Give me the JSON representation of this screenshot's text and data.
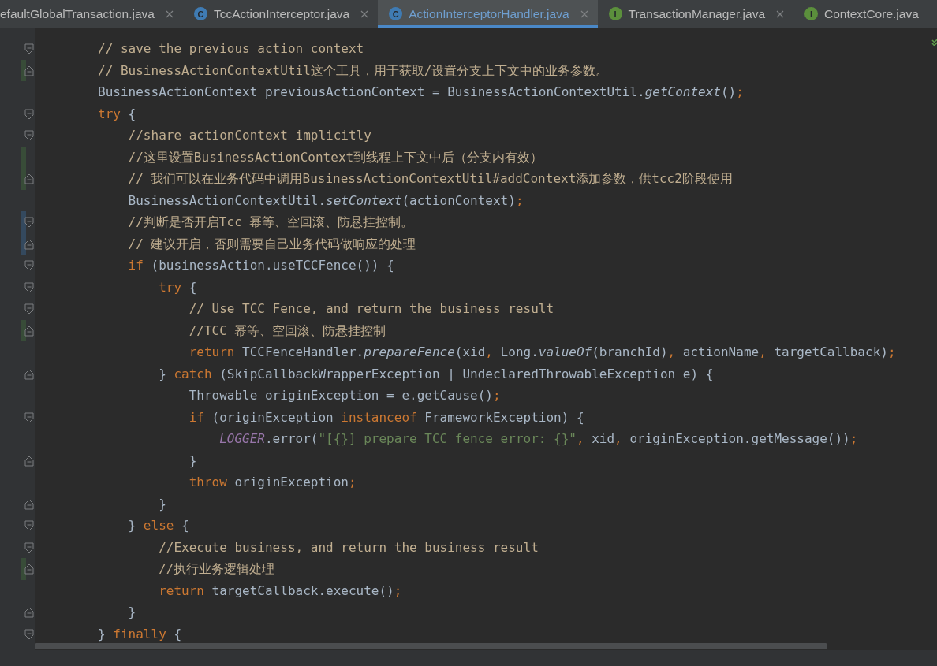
{
  "tabs": [
    {
      "label": "efaultGlobalTransaction.java",
      "selected": false,
      "closable": true
    },
    {
      "label": "TccActionInterceptor.java",
      "kind": "class",
      "icon_letter": "C",
      "selected": false,
      "closable": true
    },
    {
      "label": "ActionInterceptorHandler.java",
      "kind": "class",
      "icon_letter": "C",
      "selected": true,
      "closable": true
    },
    {
      "label": "TransactionManager.java",
      "kind": "interface",
      "icon_letter": "I",
      "selected": false,
      "closable": true
    },
    {
      "label": "ContextCore.java",
      "kind": "interface",
      "icon_letter": "I",
      "selected": false,
      "closable": false
    }
  ],
  "editor": {
    "lines": [
      {
        "fold_start": true,
        "fold_end": false,
        "tokens": [
          {
            "kind": "comment",
            "text": "// save the previous action context"
          }
        ]
      },
      {
        "fold_start": false,
        "fold_end": true,
        "color": "#384c38",
        "tokens": [
          {
            "kind": "comment",
            "text": "// BusinessActionContextUtil这个工具，用于获取/设置分支上下文中的业务参数。"
          }
        ]
      },
      {
        "fold_start": false,
        "fold_end": false,
        "tokens": [
          {
            "kind": "plain",
            "text": "BusinessActionContext previousActionContext = BusinessActionContextUtil."
          },
          {
            "kind": "method",
            "text": "getContext"
          },
          {
            "kind": "plain",
            "text": "()"
          },
          {
            "kind": "punct",
            "text": ";"
          }
        ]
      },
      {
        "fold_start": true,
        "fold_end": false,
        "tokens": [
          {
            "kind": "keyword",
            "text": "try"
          },
          {
            "kind": "plain",
            "text": " {"
          }
        ],
        "children": [
          {
            "fold_start": true,
            "fold_end": false,
            "tokens": [
              {
                "kind": "comment",
                "text": "//share actionContext implicitly"
              }
            ]
          },
          {
            "fold_start": false,
            "fold_end": false,
            "color": "#384c38",
            "tokens": [
              {
                "kind": "comment",
                "text": "//这里设置BusinessActionContext到线程上下文中后（分支内有效）"
              }
            ]
          },
          {
            "fold_start": false,
            "fold_end": true,
            "color": "#384c38",
            "tokens": [
              {
                "kind": "comment",
                "text": "// 我们可以在业务代码中调用BusinessActionContextUtil#addContext添加参数，供tcc2阶段使用"
              }
            ]
          },
          {
            "fold_start": false,
            "fold_end": false,
            "tokens": [
              {
                "kind": "plain",
                "text": "BusinessActionContextUtil."
              },
              {
                "kind": "method",
                "text": "setContext"
              },
              {
                "kind": "plain",
                "text": "(actionContext)"
              },
              {
                "kind": "punct",
                "text": ";"
              }
            ]
          },
          {
            "fold_start": true,
            "fold_end": false,
            "color": "#34495e",
            "tokens": [
              {
                "kind": "comment",
                "text": "//判断是否开启Tcc 幂等、空回滚、防悬挂控制。"
              }
            ]
          },
          {
            "fold_start": false,
            "fold_end": true,
            "color": "#34495e",
            "tokens": [
              {
                "kind": "comment",
                "text": "// 建议开启，否则需要自己业务代码做响应的处理"
              }
            ]
          },
          {
            "fold_start": true,
            "fold_end": false,
            "tokens": [
              {
                "kind": "keyword",
                "text": "if"
              },
              {
                "kind": "plain",
                "text": " (businessAction.useTCCFence()) {"
              }
            ],
            "children": [
              {
                "fold_start": true,
                "fold_end": false,
                "tokens": [
                  {
                    "kind": "keyword",
                    "text": "try"
                  },
                  {
                    "kind": "plain",
                    "text": " {"
                  }
                ],
                "children": [
                  {
                    "fold_start": true,
                    "fold_end": false,
                    "tokens": [
                      {
                        "kind": "comment",
                        "text": "// Use TCC Fence, and return the business result"
                      }
                    ]
                  },
                  {
                    "fold_start": false,
                    "fold_end": true,
                    "color": "#384c38",
                    "tokens": [
                      {
                        "kind": "comment",
                        "text": "//TCC 幂等、空回滚、防悬挂控制"
                      }
                    ]
                  },
                  {
                    "fold_start": false,
                    "fold_end": false,
                    "tokens": [
                      {
                        "kind": "keyword",
                        "text": "return"
                      },
                      {
                        "kind": "plain",
                        "text": " TCCFenceHandler."
                      },
                      {
                        "kind": "method",
                        "text": "prepareFence"
                      },
                      {
                        "kind": "plain",
                        "text": "(xid"
                      },
                      {
                        "kind": "punct",
                        "text": ", "
                      },
                      {
                        "kind": "plain",
                        "text": "Long."
                      },
                      {
                        "kind": "method",
                        "text": "valueOf"
                      },
                      {
                        "kind": "plain",
                        "text": "(branchId)"
                      },
                      {
                        "kind": "punct",
                        "text": ", "
                      },
                      {
                        "kind": "plain",
                        "text": "actionName"
                      },
                      {
                        "kind": "punct",
                        "text": ", "
                      },
                      {
                        "kind": "plain",
                        "text": "targetCallback)"
                      },
                      {
                        "kind": "punct",
                        "text": ";"
                      }
                    ]
                  }
                ]
              },
              {
                "fold_start": false,
                "fold_end": true,
                "tokens": [
                  {
                    "kind": "plain",
                    "text": "} "
                  },
                  {
                    "kind": "keyword",
                    "text": "catch"
                  },
                  {
                    "kind": "plain",
                    "text": " (SkipCallbackWrapperException | UndeclaredThrowableException e) {"
                  }
                ],
                "children": [
                  {
                    "fold_start": false,
                    "fold_end": false,
                    "tokens": [
                      {
                        "kind": "plain",
                        "text": "Throwable originException = e.getCause()"
                      },
                      {
                        "kind": "punct",
                        "text": ";"
                      }
                    ]
                  },
                  {
                    "fold_start": true,
                    "fold_end": false,
                    "tokens": [
                      {
                        "kind": "keyword",
                        "text": "if"
                      },
                      {
                        "kind": "plain",
                        "text": " (originException "
                      },
                      {
                        "kind": "keyword",
                        "text": "instanceof"
                      },
                      {
                        "kind": "plain",
                        "text": " FrameworkException) {"
                      }
                    ],
                    "children": [
                      {
                        "fold_start": false,
                        "fold_end": false,
                        "tokens": [
                          {
                            "kind": "constant",
                            "text": "LOGGER"
                          },
                          {
                            "kind": "plain",
                            "text": ".error("
                          },
                          {
                            "kind": "string",
                            "text": "\"[{}] prepare TCC fence error: {}\""
                          },
                          {
                            "kind": "punct",
                            "text": ", "
                          },
                          {
                            "kind": "plain",
                            "text": "xid"
                          },
                          {
                            "kind": "punct",
                            "text": ", "
                          },
                          {
                            "kind": "plain",
                            "text": "originException.getMessage())"
                          },
                          {
                            "kind": "punct",
                            "text": ";"
                          }
                        ]
                      }
                    ]
                  },
                  {
                    "fold_start": false,
                    "fold_end": true,
                    "tokens": [
                      {
                        "kind": "plain",
                        "text": "}"
                      }
                    ]
                  },
                  {
                    "fold_start": false,
                    "fold_end": false,
                    "tokens": [
                      {
                        "kind": "keyword",
                        "text": "throw"
                      },
                      {
                        "kind": "plain",
                        "text": " originException"
                      },
                      {
                        "kind": "punct",
                        "text": ";"
                      }
                    ]
                  }
                ]
              },
              {
                "fold_start": false,
                "fold_end": true,
                "tokens": [
                  {
                    "kind": "plain",
                    "text": "}"
                  }
                ]
              }
            ]
          },
          {
            "fold_start": true,
            "fold_end": false,
            "tokens": [
              {
                "kind": "plain",
                "text": "} "
              },
              {
                "kind": "keyword",
                "text": "else"
              },
              {
                "kind": "plain",
                "text": " {"
              }
            ],
            "children": [
              {
                "fold_start": true,
                "fold_end": false,
                "tokens": [
                  {
                    "kind": "comment",
                    "text": "//Execute business, and return the business result"
                  }
                ]
              },
              {
                "fold_start": false,
                "fold_end": true,
                "color": "#384c38",
                "tokens": [
                  {
                    "kind": "comment",
                    "text": "//执行业务逻辑处理"
                  }
                ]
              },
              {
                "fold_start": false,
                "fold_end": false,
                "tokens": [
                  {
                    "kind": "keyword",
                    "text": "return"
                  },
                  {
                    "kind": "plain",
                    "text": " targetCallback.execute()"
                  },
                  {
                    "kind": "punct",
                    "text": ";"
                  }
                ]
              }
            ]
          },
          {
            "fold_start": false,
            "fold_end": true,
            "tokens": [
              {
                "kind": "plain",
                "text": "}"
              }
            ]
          }
        ]
      },
      {
        "fold_start": true,
        "fold_end": false,
        "tokens": [
          {
            "kind": "plain",
            "text": "} "
          },
          {
            "kind": "keyword",
            "text": "finally"
          },
          {
            "kind": "plain",
            "text": " {"
          }
        ]
      }
    ]
  }
}
